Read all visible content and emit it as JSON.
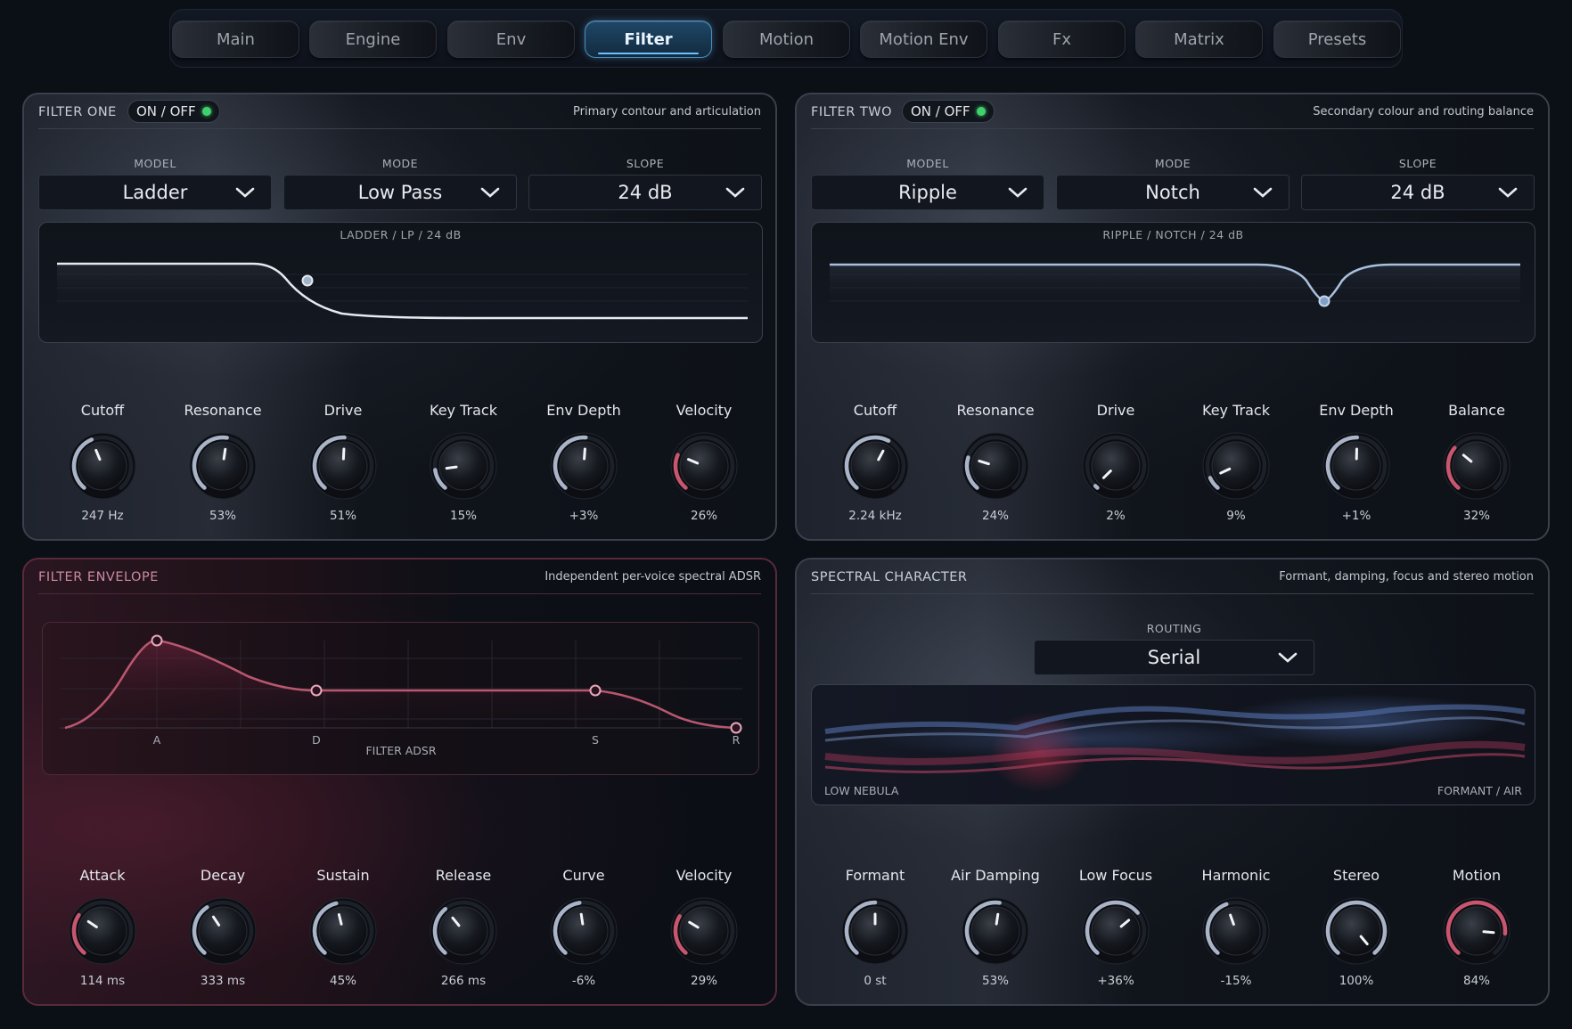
{
  "tabs": [
    {
      "label": "Main",
      "active": false
    },
    {
      "label": "Engine",
      "active": false
    },
    {
      "label": "Env",
      "active": false
    },
    {
      "label": "Filter",
      "active": true
    },
    {
      "label": "Motion",
      "active": false
    },
    {
      "label": "Motion Env",
      "active": false
    },
    {
      "label": "Fx",
      "active": false
    },
    {
      "label": "Matrix",
      "active": false
    },
    {
      "label": "Presets",
      "active": false
    }
  ],
  "colors": {
    "knob_arc": "#aab4c8",
    "knob_arc_accent": "#c8566e",
    "accent_blue": "#4a8fc0",
    "led_on": "#3fd26c"
  },
  "filter_one": {
    "title": "FILTER ONE",
    "toggle_label": "ON / OFF",
    "subtitle": "Primary contour and articulation",
    "model_label": "MODEL",
    "model_value": "Ladder",
    "mode_label": "MODE",
    "mode_value": "Low Pass",
    "slope_label": "SLOPE",
    "slope_value": "24 dB",
    "graph_caption": "LADDER  /  LP  /  24 dB",
    "knobs": [
      {
        "label": "Cutoff",
        "value": "247 Hz",
        "level": 0.42
      },
      {
        "label": "Resonance",
        "value": "53%",
        "level": 0.53
      },
      {
        "label": "Drive",
        "value": "51%",
        "level": 0.51
      },
      {
        "label": "Key Track",
        "value": "15%",
        "level": 0.15
      },
      {
        "label": "Env Depth",
        "value": "+3%",
        "level": 0.515
      },
      {
        "label": "Velocity",
        "value": "26%",
        "level": 0.26,
        "accent": true
      }
    ]
  },
  "filter_two": {
    "title": "FILTER TWO",
    "toggle_label": "ON / OFF",
    "subtitle": "Secondary colour and routing balance",
    "model_label": "MODEL",
    "model_value": "Ripple",
    "mode_label": "MODE",
    "mode_value": "Notch",
    "slope_label": "SLOPE",
    "slope_value": "24 dB",
    "graph_caption": "RIPPLE  /  NOTCH  /  24 dB",
    "knobs": [
      {
        "label": "Cutoff",
        "value": "2.24 kHz",
        "level": 0.6
      },
      {
        "label": "Resonance",
        "value": "24%",
        "level": 0.24
      },
      {
        "label": "Drive",
        "value": "2%",
        "level": 0.02
      },
      {
        "label": "Key Track",
        "value": "9%",
        "level": 0.09
      },
      {
        "label": "Env Depth",
        "value": "+1%",
        "level": 0.505
      },
      {
        "label": "Balance",
        "value": "32%",
        "level": 0.32,
        "accent": true
      }
    ]
  },
  "filter_envelope": {
    "title": "FILTER ENVELOPE",
    "subtitle": "Independent per-voice spectral ADSR",
    "graph_caption": "FILTER ADSR",
    "stage_labels": [
      "A",
      "D",
      "S",
      "R"
    ],
    "knobs": [
      {
        "label": "Attack",
        "value": "114 ms",
        "level": 0.3,
        "accent": true
      },
      {
        "label": "Decay",
        "value": "333 ms",
        "level": 0.38
      },
      {
        "label": "Sustain",
        "value": "45%",
        "level": 0.45
      },
      {
        "label": "Release",
        "value": "266 ms",
        "level": 0.36
      },
      {
        "label": "Curve",
        "value": "-6%",
        "level": 0.47
      },
      {
        "label": "Velocity",
        "value": "29%",
        "level": 0.29,
        "accent": true
      }
    ]
  },
  "spectral": {
    "title": "SPECTRAL CHARACTER",
    "subtitle": "Formant, damping, focus and stereo motion",
    "routing_label": "ROUTING",
    "routing_value": "Serial",
    "viz_left": "LOW NEBULA",
    "viz_right": "FORMANT / AIR",
    "knobs": [
      {
        "label": "Formant",
        "value": "0 st",
        "level": 0.5
      },
      {
        "label": "Air Damping",
        "value": "53%",
        "level": 0.53
      },
      {
        "label": "Low Focus",
        "value": "+36%",
        "level": 0.68
      },
      {
        "label": "Harmonic",
        "value": "-15%",
        "level": 0.43
      },
      {
        "label": "Stereo",
        "value": "100%",
        "level": 1.0
      },
      {
        "label": "Motion",
        "value": "84%",
        "level": 0.84,
        "accent": true
      }
    ]
  }
}
